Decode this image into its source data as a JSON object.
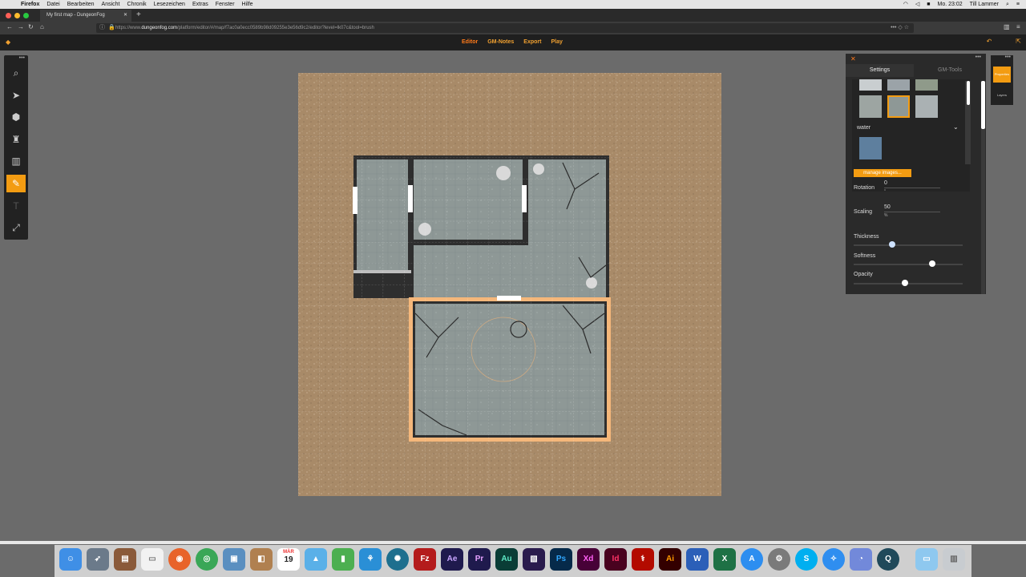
{
  "menubar": {
    "app": "Firefox",
    "menus": [
      "Datei",
      "Bearbeiten",
      "Ansicht",
      "Chronik",
      "Lesezeichen",
      "Extras",
      "Fenster",
      "Hilfe"
    ],
    "clock": "Mo. 23:02",
    "user": "Till Lammer"
  },
  "browser": {
    "tab_title": "My first map - DungeonFog",
    "url_prefix": "https://www.",
    "url_domain": "dungeonfog.com",
    "url_path": "/platform/editor/#/map/f7ac0a0ecc0589b98d09255e3e56d9c2/editor?level=lk07c&tool=brush"
  },
  "app": {
    "nav": [
      "Editor",
      "GM-Notes",
      "Export",
      "Play"
    ],
    "active_nav": "Editor"
  },
  "panel": {
    "tabs": [
      "Settings",
      "GM-Tools"
    ],
    "texture_group": "water",
    "manage_button": "manage images...",
    "rotation_label": "Rotation",
    "rotation_value": "0",
    "rotation_unit": "°",
    "scaling_label": "Scaling",
    "scaling_value": "50",
    "scaling_unit": "%",
    "thickness_label": "Thickness",
    "thickness_level": 0.35,
    "softness_label": "Softness",
    "softness_level": 0.72,
    "opacity_label": "Opacity",
    "opacity_level": 0.47
  },
  "side_strip": {
    "properties": "Properties",
    "layers": "Layers"
  },
  "dock": {
    "date_month": "MÄR",
    "date_day": "19",
    "labels": [
      "Ae",
      "Pr",
      "Au",
      "Ps",
      "Xd",
      "Id",
      "Ai"
    ]
  },
  "colors": {
    "accent": "#f39c12",
    "sand": "#a88a68",
    "floor": "#8e9896",
    "wall": "#2e2e2e"
  }
}
